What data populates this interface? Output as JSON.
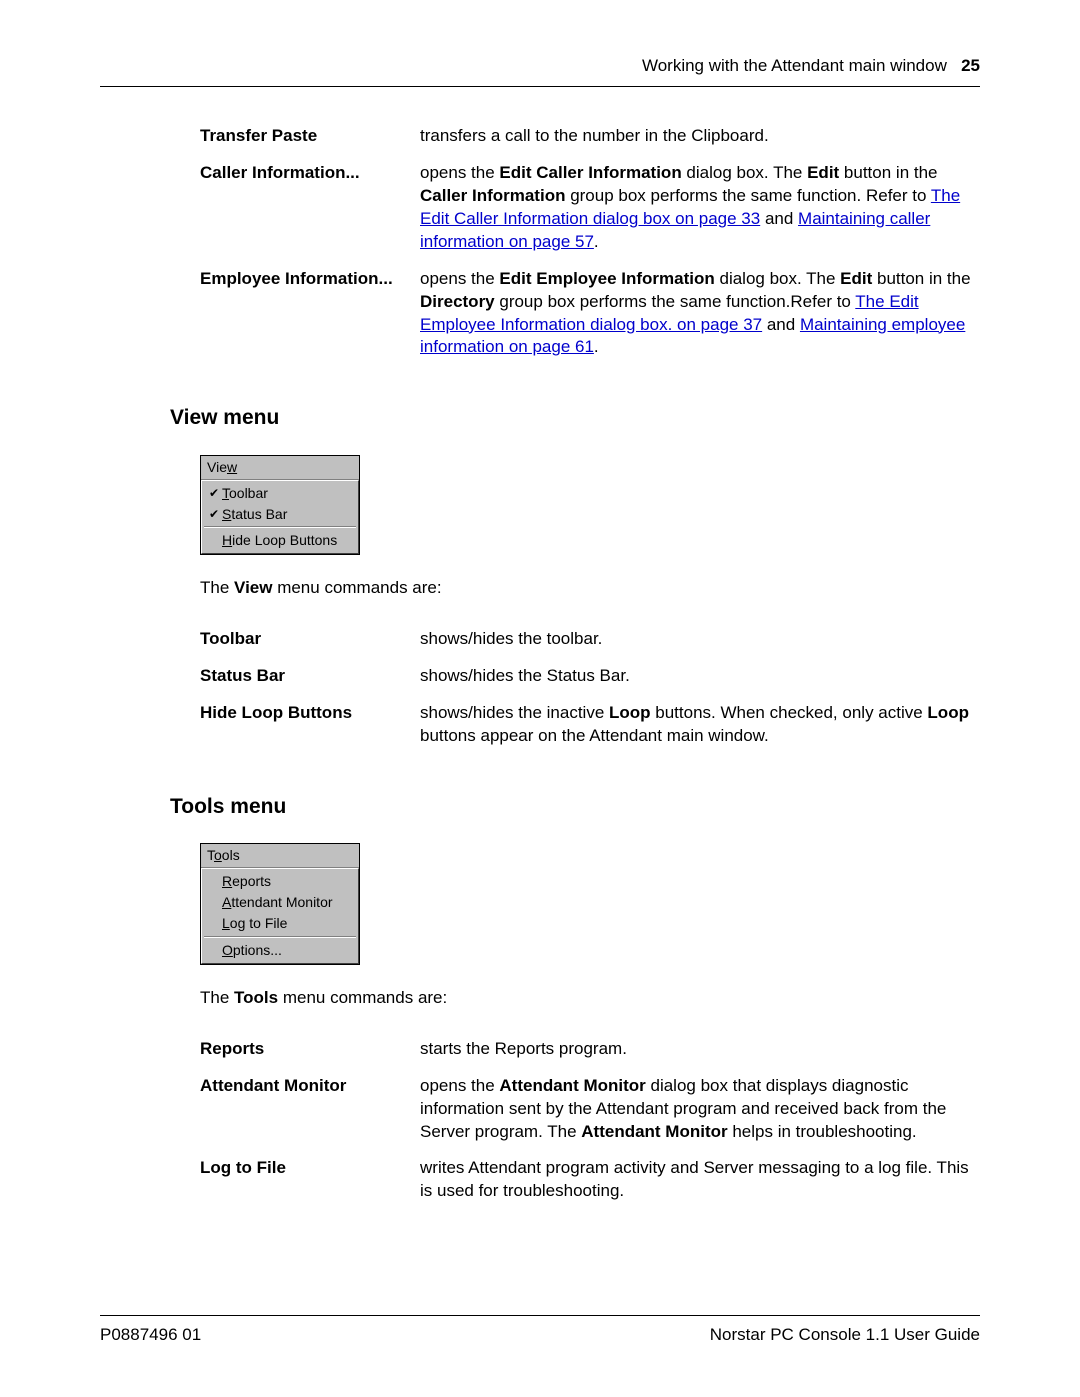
{
  "header": {
    "text": "Working with the Attendant main window",
    "page": "25"
  },
  "edit_menu_tail": [
    {
      "term": "Transfer Paste",
      "desc_plain": "transfers a call to the number in the Clipboard."
    },
    {
      "term": "Caller Information...",
      "desc_html": "opens the <b>Edit Caller Information</b> dialog box. The <b>Edit</b> button in the <b>Caller Information</b> group box performs the same function. Refer to <a class='cross' href='#'>The Edit Caller Information dialog box on page 33</a> and <a class='cross' href='#'>Maintaining caller information on page 57</a>."
    },
    {
      "term": "Employee Information...",
      "desc_html": "opens the <b>Edit Employee Information</b> dialog box. The <b>Edit</b> button in the <b>Directory</b> group box performs the same function.Refer to <a class='cross' href='#'>The Edit Employee Information dialog box. on page 37</a> and <a class='cross' href='#'>Maintaining employee information on page 61</a>."
    }
  ],
  "view": {
    "heading": "View menu",
    "menu_title": "View",
    "items": [
      {
        "label": "Toolbar",
        "checked": true,
        "underline_index": 0
      },
      {
        "label": "Status Bar",
        "checked": true,
        "underline_index": 0
      },
      {
        "sep": true
      },
      {
        "label": "Hide Loop Buttons",
        "checked": false,
        "underline_index": 0
      }
    ],
    "intro_html": "The <b>View</b> menu commands are:",
    "rows": [
      {
        "term": "Toolbar",
        "desc_plain": "shows/hides the toolbar."
      },
      {
        "term": "Status Bar",
        "desc_plain": "shows/hides the Status Bar."
      },
      {
        "term": "Hide Loop Buttons",
        "desc_html": "shows/hides the inactive <b>Loop</b> buttons. When checked, only active <b>Loop</b> buttons appear on the Attendant main window."
      }
    ]
  },
  "tools": {
    "heading": "Tools menu",
    "menu_title": "Tools",
    "items": [
      {
        "label": "Reports",
        "underline_index": 0
      },
      {
        "label": "Attendant Monitor",
        "underline_index": 0
      },
      {
        "label": "Log to File",
        "underline_index": 0
      },
      {
        "sep": true
      },
      {
        "label": "Options...",
        "underline_index": 0
      }
    ],
    "intro_html": "The <b>Tools</b> menu commands are:",
    "rows": [
      {
        "term": "Reports",
        "desc_plain": "starts the Reports program."
      },
      {
        "term": "Attendant Monitor",
        "desc_html": "opens the <b>Attendant Monitor</b> dialog box that displays diagnostic information sent by the Attendant program and received back from the Server program. The <b>Attendant Monitor</b> helps in troubleshooting."
      },
      {
        "term": "Log to File",
        "desc_plain": "writes Attendant program activity and Server messaging to a log file. This is used for troubleshooting."
      }
    ]
  },
  "footer": {
    "left": "P0887496 01",
    "right": "Norstar PC Console 1.1 User Guide"
  }
}
